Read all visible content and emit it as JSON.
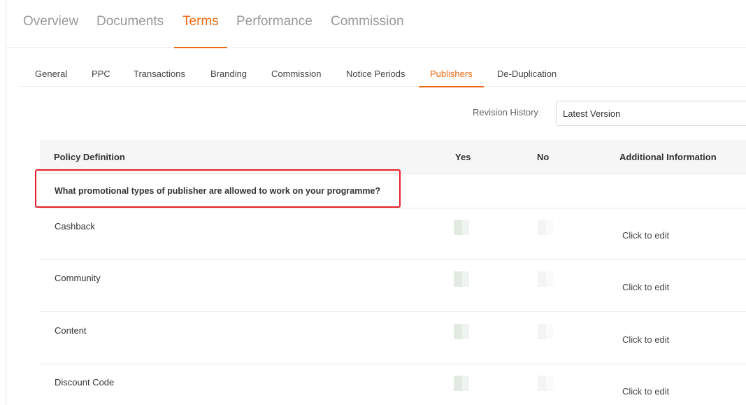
{
  "top_tabs": [
    {
      "label": "Overview",
      "active": false
    },
    {
      "label": "Documents",
      "active": false
    },
    {
      "label": "Terms",
      "active": true
    },
    {
      "label": "Performance",
      "active": false
    },
    {
      "label": "Commission",
      "active": false
    }
  ],
  "sub_tabs": [
    {
      "label": "General",
      "active": false
    },
    {
      "label": "PPC",
      "active": false
    },
    {
      "label": "Transactions",
      "active": false
    },
    {
      "label": "Branding",
      "active": false
    },
    {
      "label": "Commission",
      "active": false
    },
    {
      "label": "Notice Periods",
      "active": false
    },
    {
      "label": "Publishers",
      "active": true
    },
    {
      "label": "De-Duplication",
      "active": false
    }
  ],
  "revision": {
    "label": "Revision History",
    "selected": "Latest Version"
  },
  "table": {
    "headers": {
      "policy": "Policy Definition",
      "yes": "Yes",
      "no": "No",
      "info": "Additional Information"
    },
    "question": "What promotional types of publisher are allowed to work on your programme?",
    "rows": [
      {
        "label": "Cashback",
        "info": "Click to edit"
      },
      {
        "label": "Community",
        "info": "Click to edit"
      },
      {
        "label": "Content",
        "info": "Click to edit"
      },
      {
        "label": "Discount Code",
        "info": "Click to edit"
      }
    ]
  },
  "colors": {
    "accent": "#ee6a12",
    "highlight": "#e8202a"
  }
}
